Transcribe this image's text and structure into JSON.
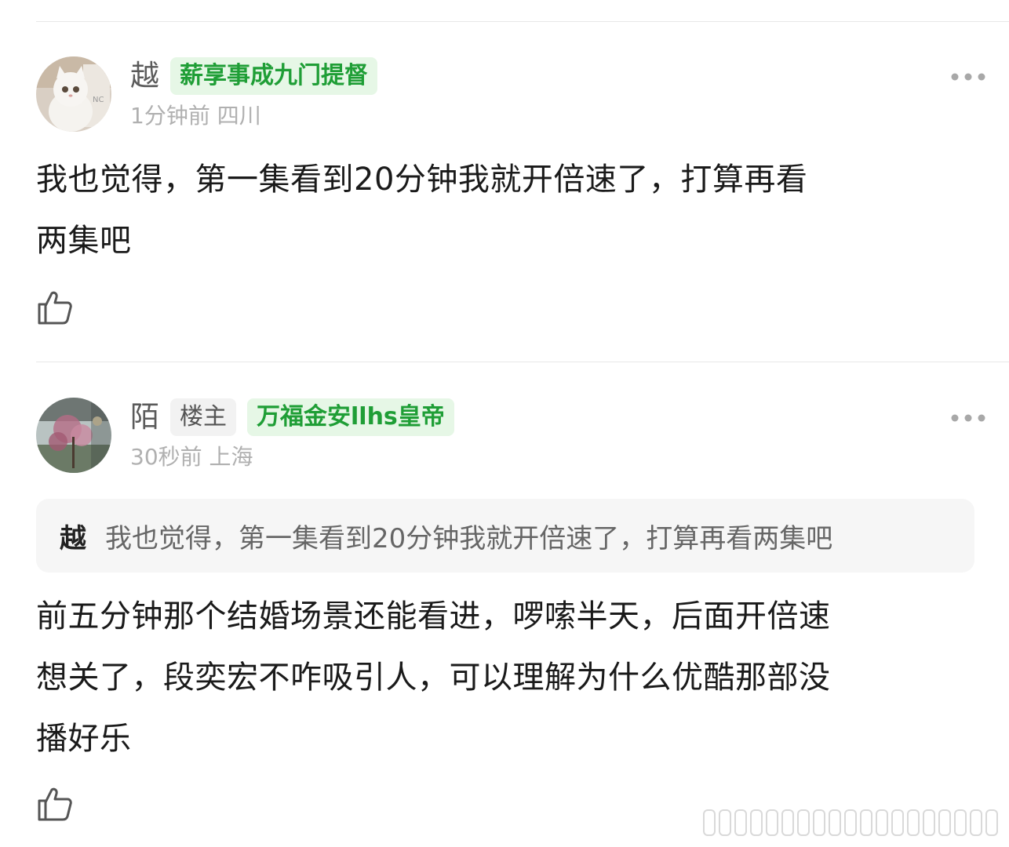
{
  "comments": [
    {
      "username": "越",
      "badges": [
        {
          "text": "薪享事成九门提督",
          "style": "green"
        }
      ],
      "meta": "1分钟前 四川",
      "body_lines": [
        "我也觉得，第一集看到20分钟我就开倍速了，打算再看",
        "两集吧"
      ],
      "avatar_icon": "white-cat-avatar",
      "like_icon": "thumbs-up-icon",
      "more_icon": "more-dots-icon"
    },
    {
      "username": "陌",
      "badges": [
        {
          "text": "楼主",
          "style": "gray"
        },
        {
          "text": "万福金安llhs皇帝",
          "style": "green"
        }
      ],
      "meta": "30秒前 上海",
      "quote": {
        "author": "越",
        "text": "我也觉得，第一集看到20分钟我就开倍速了，打算再看两集吧"
      },
      "body_lines": [
        "前五分钟那个结婚场景还能看进，啰嗦半天，后面开倍速",
        "想关了，段奕宏不咋吸引人，可以理解为什么优酷那部没",
        "播好乐"
      ],
      "avatar_icon": "flower-tree-avatar",
      "like_icon": "thumbs-up-icon",
      "more_icon": "more-dots-icon"
    }
  ],
  "colors": {
    "badge_green_bg": "#e6f7e6",
    "badge_green_text": "#1f9e36",
    "meta_text": "#b0b0b0"
  }
}
